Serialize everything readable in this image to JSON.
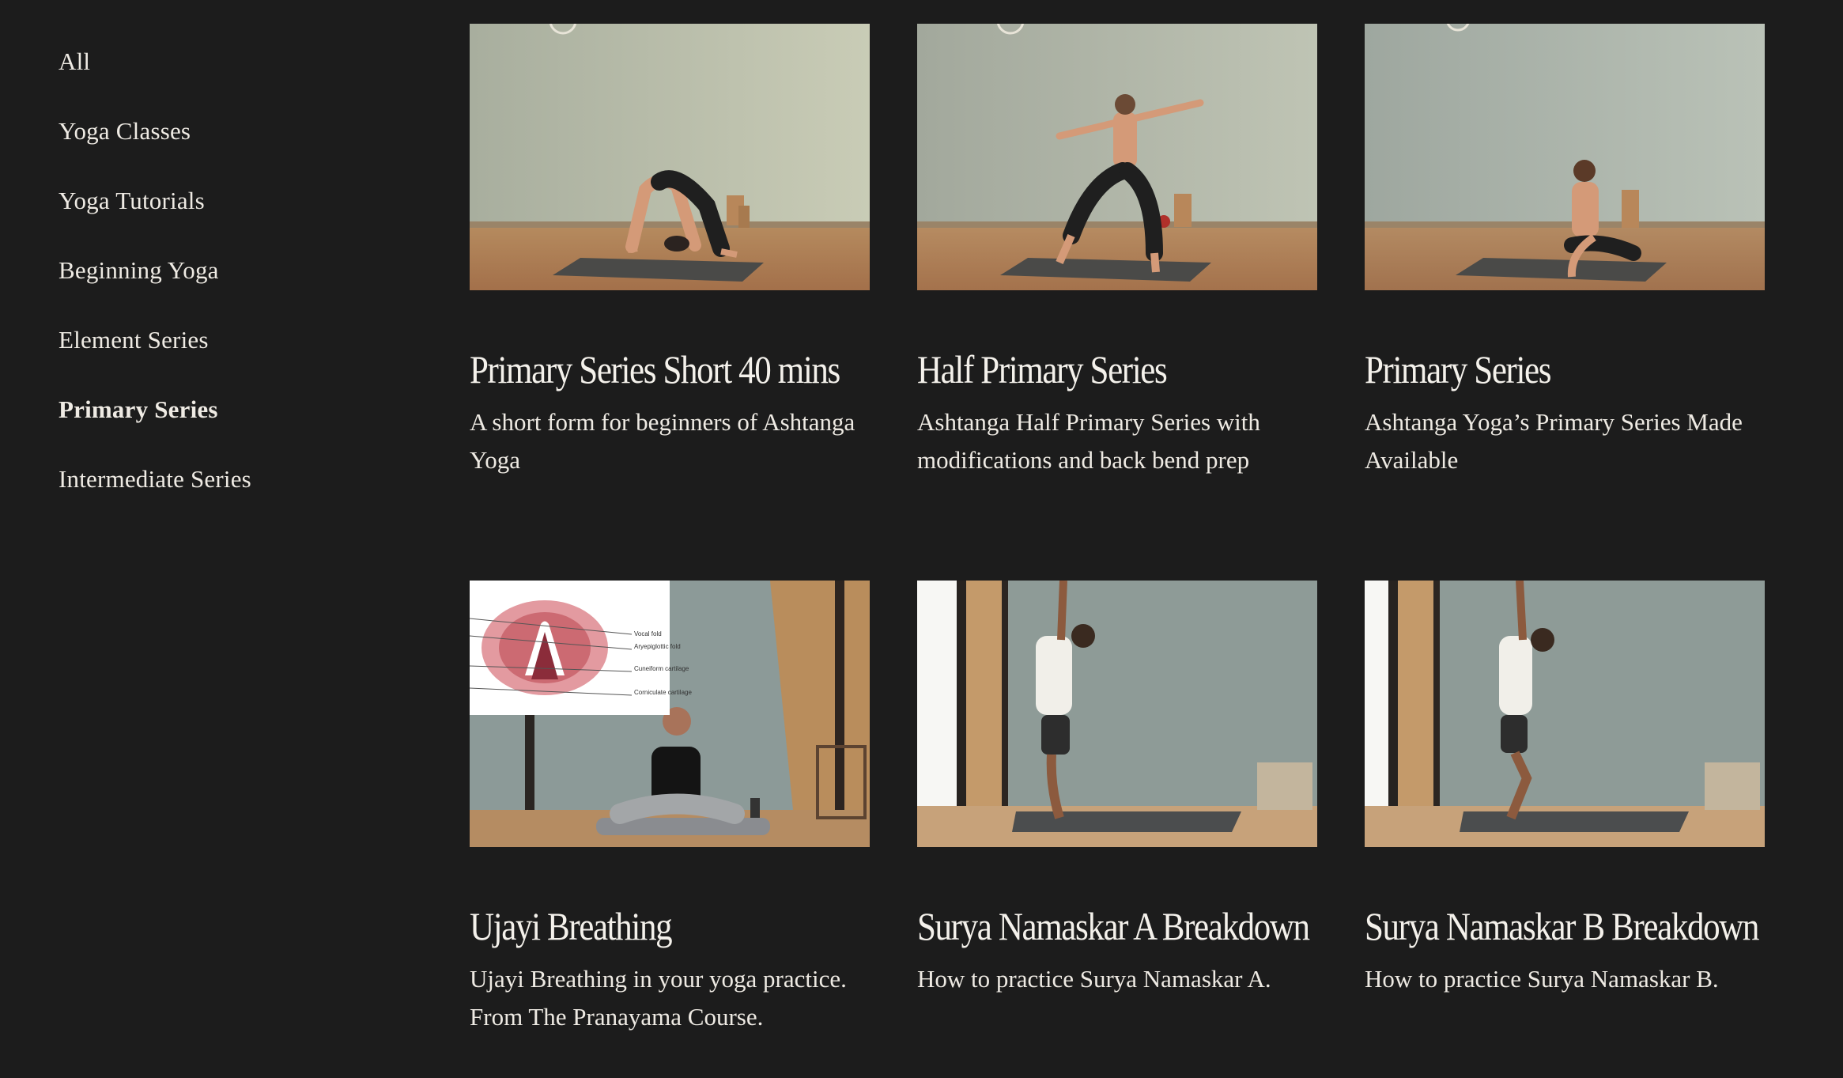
{
  "sidebar": {
    "items": [
      {
        "label": "All",
        "active": false
      },
      {
        "label": "Yoga Classes",
        "active": false
      },
      {
        "label": "Yoga Tutorials",
        "active": false
      },
      {
        "label": "Beginning Yoga",
        "active": false
      },
      {
        "label": "Element Series",
        "active": false
      },
      {
        "label": "Primary Series",
        "active": true
      },
      {
        "label": "Intermediate Series",
        "active": false
      }
    ]
  },
  "cards": [
    {
      "title": "Primary Series Short 40 mins",
      "description": "A short form for beginners of Ashtanga Yoga"
    },
    {
      "title": "Half Primary Series",
      "description": "Ashtanga Half Primary Series with modifications and back bend prep"
    },
    {
      "title": "Primary Series",
      "description": "Ashtanga Yoga’s Primary Series Made Available"
    },
    {
      "title": "Ujayi Breathing",
      "description": "Ujayi Breathing in your yoga practice. From The Pranayama Course."
    },
    {
      "title": "Surya Namaskar A Breakdown",
      "description": "How to practice Surya Namaskar A."
    },
    {
      "title": "Surya Namaskar B Breakdown",
      "description": "How to practice Surya Namaskar B."
    }
  ],
  "diagram_labels": [
    "Vocal fold",
    "Aryepiglottic fold",
    "Cuneiform cartilage",
    "Corniculate cartilage"
  ]
}
